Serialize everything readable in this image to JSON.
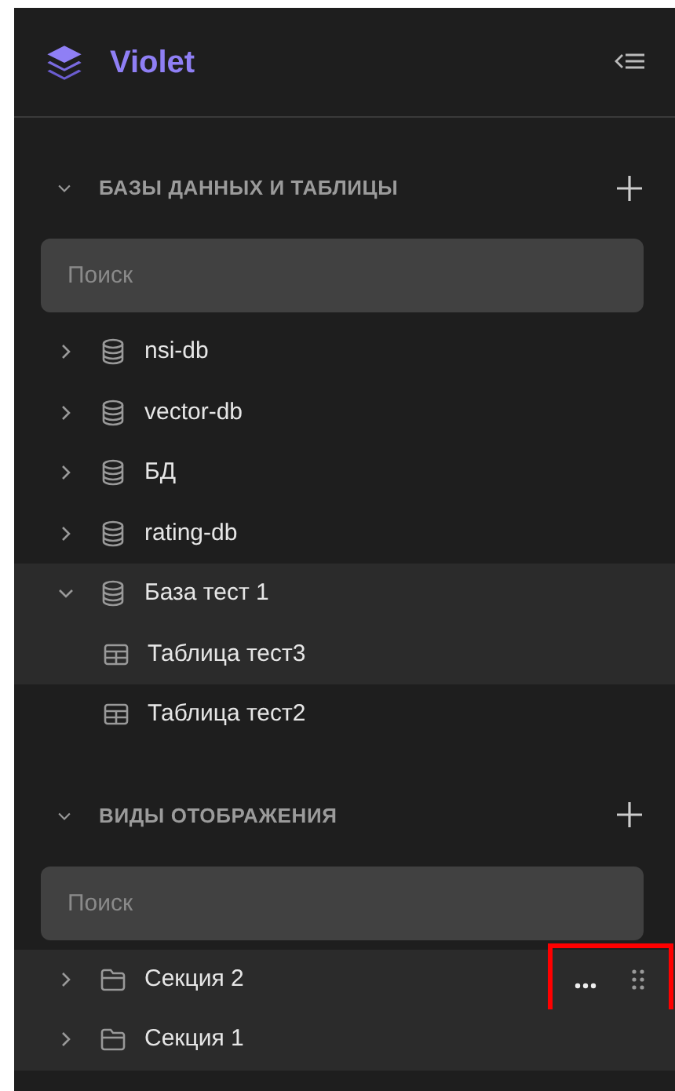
{
  "app": {
    "name": "Violet"
  },
  "sections": [
    {
      "title": "БАЗЫ ДАННЫХ И ТАБЛИЦЫ",
      "expanded": true,
      "search": {
        "placeholder": "Поиск"
      },
      "items": [
        {
          "kind": "database",
          "label": "nsi-db",
          "expanded": false,
          "highlighted": false
        },
        {
          "kind": "database",
          "label": "vector-db",
          "expanded": false,
          "highlighted": false
        },
        {
          "kind": "database",
          "label": "БД",
          "expanded": false,
          "highlighted": false
        },
        {
          "kind": "database",
          "label": "rating-db",
          "expanded": false,
          "highlighted": false
        },
        {
          "kind": "database",
          "label": "База тест 1",
          "expanded": true,
          "highlighted": true,
          "children": [
            {
              "kind": "table",
              "label": "Таблица тест3",
              "highlighted": true
            },
            {
              "kind": "table",
              "label": "Таблица тест2",
              "highlighted": false
            }
          ]
        }
      ]
    },
    {
      "title": "ВИДЫ ОТОБРАЖЕНИЯ",
      "expanded": true,
      "search": {
        "placeholder": "Поиск"
      },
      "items": [
        {
          "kind": "folder",
          "label": "Секция 2",
          "expanded": false,
          "highlighted": true,
          "hovered": true
        },
        {
          "kind": "folder",
          "label": "Секция 1",
          "expanded": false,
          "highlighted": true,
          "hovered": false
        }
      ]
    }
  ]
}
